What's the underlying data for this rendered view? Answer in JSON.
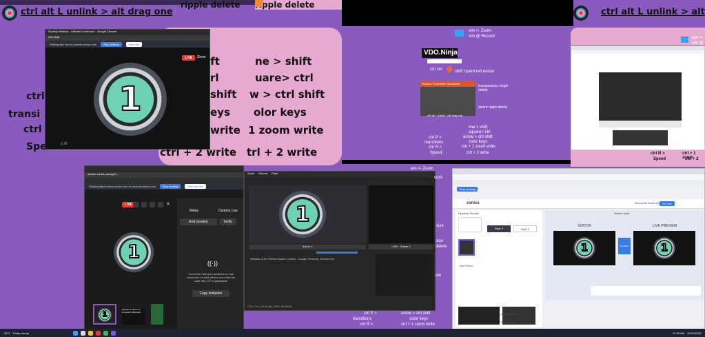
{
  "top_left": {
    "title": "ctrl alt L unlink > alt drag one",
    "tabs": [
      "ripple delete",
      "ripple delete"
    ]
  },
  "top_right": {
    "title": "ctrl alt L unlink > alt dr"
  },
  "left_text": {
    "lines": [
      "ctrl",
      "transi",
      "ctrl",
      "Speed"
    ]
  },
  "center_panel": {
    "lines": [
      "ne > shift",
      "uare> ctrl",
      "w > ctrl shift",
      "olor keys",
      "1 zoom write",
      "trl + 2  write"
    ],
    "left_lines": [
      "ift",
      "rl",
      "shift",
      "eys",
      "write",
      "ctrl + 2  write"
    ]
  },
  "small_window": {
    "title": "Rooftop Window - Ultimate Contractor - Google Chrome",
    "url": "obs.ninja",
    "share_text": "Sharing this tab to console.zonics.com",
    "stop_button": "Stop sharing",
    "view_button": "View tab",
    "live_label": "LIVE",
    "show_label": "Show",
    "number": "1",
    "timer": "1:36"
  },
  "vdo": {
    "brand": "VDO.Ninja",
    "hotkeys": [
      "win <- Zoom",
      "win @ Record"
    ],
    "shift_note": "shift +paint.net resize",
    "ctrl_ctrl": "ctrl ctrl",
    "card_title": "Resolve PowerSoft Cheatsheet",
    "notes": [
      "transparency single delete",
      "desire ripple delete",
      "ctrl alt L unlink > alt drag one"
    ],
    "list": [
      "line > shift",
      "square> ctrl",
      "arrow > ctrl shift",
      "color keys",
      "ctrl + 1 zoom write",
      "ctrl + 2  write"
    ],
    "ctrl_lines": [
      "ctrl P >",
      "transitions",
      "ctrl R >",
      "Speed"
    ]
  },
  "right_small": {
    "lines": [
      "ctrl R >",
      "Speed",
      "ctrl + 1 zoom",
      "ctrl + 2"
    ],
    "win_lines": [
      "win <-",
      "win @"
    ]
  },
  "bottom_left": {
    "url": "stream.zonics.com/gui?...",
    "share_text": "Sharing https://www.zonics.com to console.zonics.com",
    "stop_button": "Stop sharing",
    "hide_button": "Hide this bar",
    "live": "LIVE",
    "notes_tab": "Notes",
    "comms_tab": "Comms Live",
    "end_session": "End session",
    "invite": "Invite",
    "invite_text": "You're live! Ask your audience to visit zonics.live on their device and enter the code 964 707 to participate",
    "copy_invitation": "Copy invitation",
    "number": "1",
    "thumb_caption": "Episode 1 Figure 17 Computer Illustration"
  },
  "obs": {
    "source": "Window: [Live Stream Studio | zonics - Google Chrome]: chrome.exe",
    "scene": "Scene 1",
    "live_label": "LIVE - Scene 1",
    "status": "CPU: 2% | 60.00 fps | REC 00:00:00",
    "menu": [
      "Zoom",
      "Record",
      "Paint"
    ],
    "number": "1"
  },
  "bottom_mid_overlay": {
    "lines": [
      "wis <- Zoom",
      "cord",
      "size",
      "ace",
      "delete",
      "ete"
    ],
    "lower": [
      "arrow > ctrl shift",
      "color keys",
      "ctrl + 1 zoom write"
    ],
    "ctrl_lines": [
      "ctrl P >",
      "transitions",
      "ctrl R >"
    ]
  },
  "studio": {
    "app": "zonics",
    "mode": "Studio mode",
    "editor": "EDITOR",
    "live_preview": "LIVE PREVIEW",
    "transition": "Transition",
    "dynamic_scenes": "Dynamic Scenes",
    "style3": "Style 3",
    "style4": "Style 4",
    "show_label": "Show",
    "add_scene": "Add Scene",
    "add_camera": "Add Camera",
    "invite_crew": "Invite Crew",
    "number": "1",
    "go_live": "Go Live",
    "broadcast": "Broadcast Destination"
  },
  "taskbar": {
    "weather": "26°C",
    "weather_desc": "Partly cloudy",
    "time": "11:35 AM",
    "date": "10/31/2023"
  },
  "colors": {
    "background": "#8a5bbf",
    "panel_pink": "#e6a9cf",
    "live_red": "#e8362c",
    "accent_blue": "#3b7be6"
  }
}
